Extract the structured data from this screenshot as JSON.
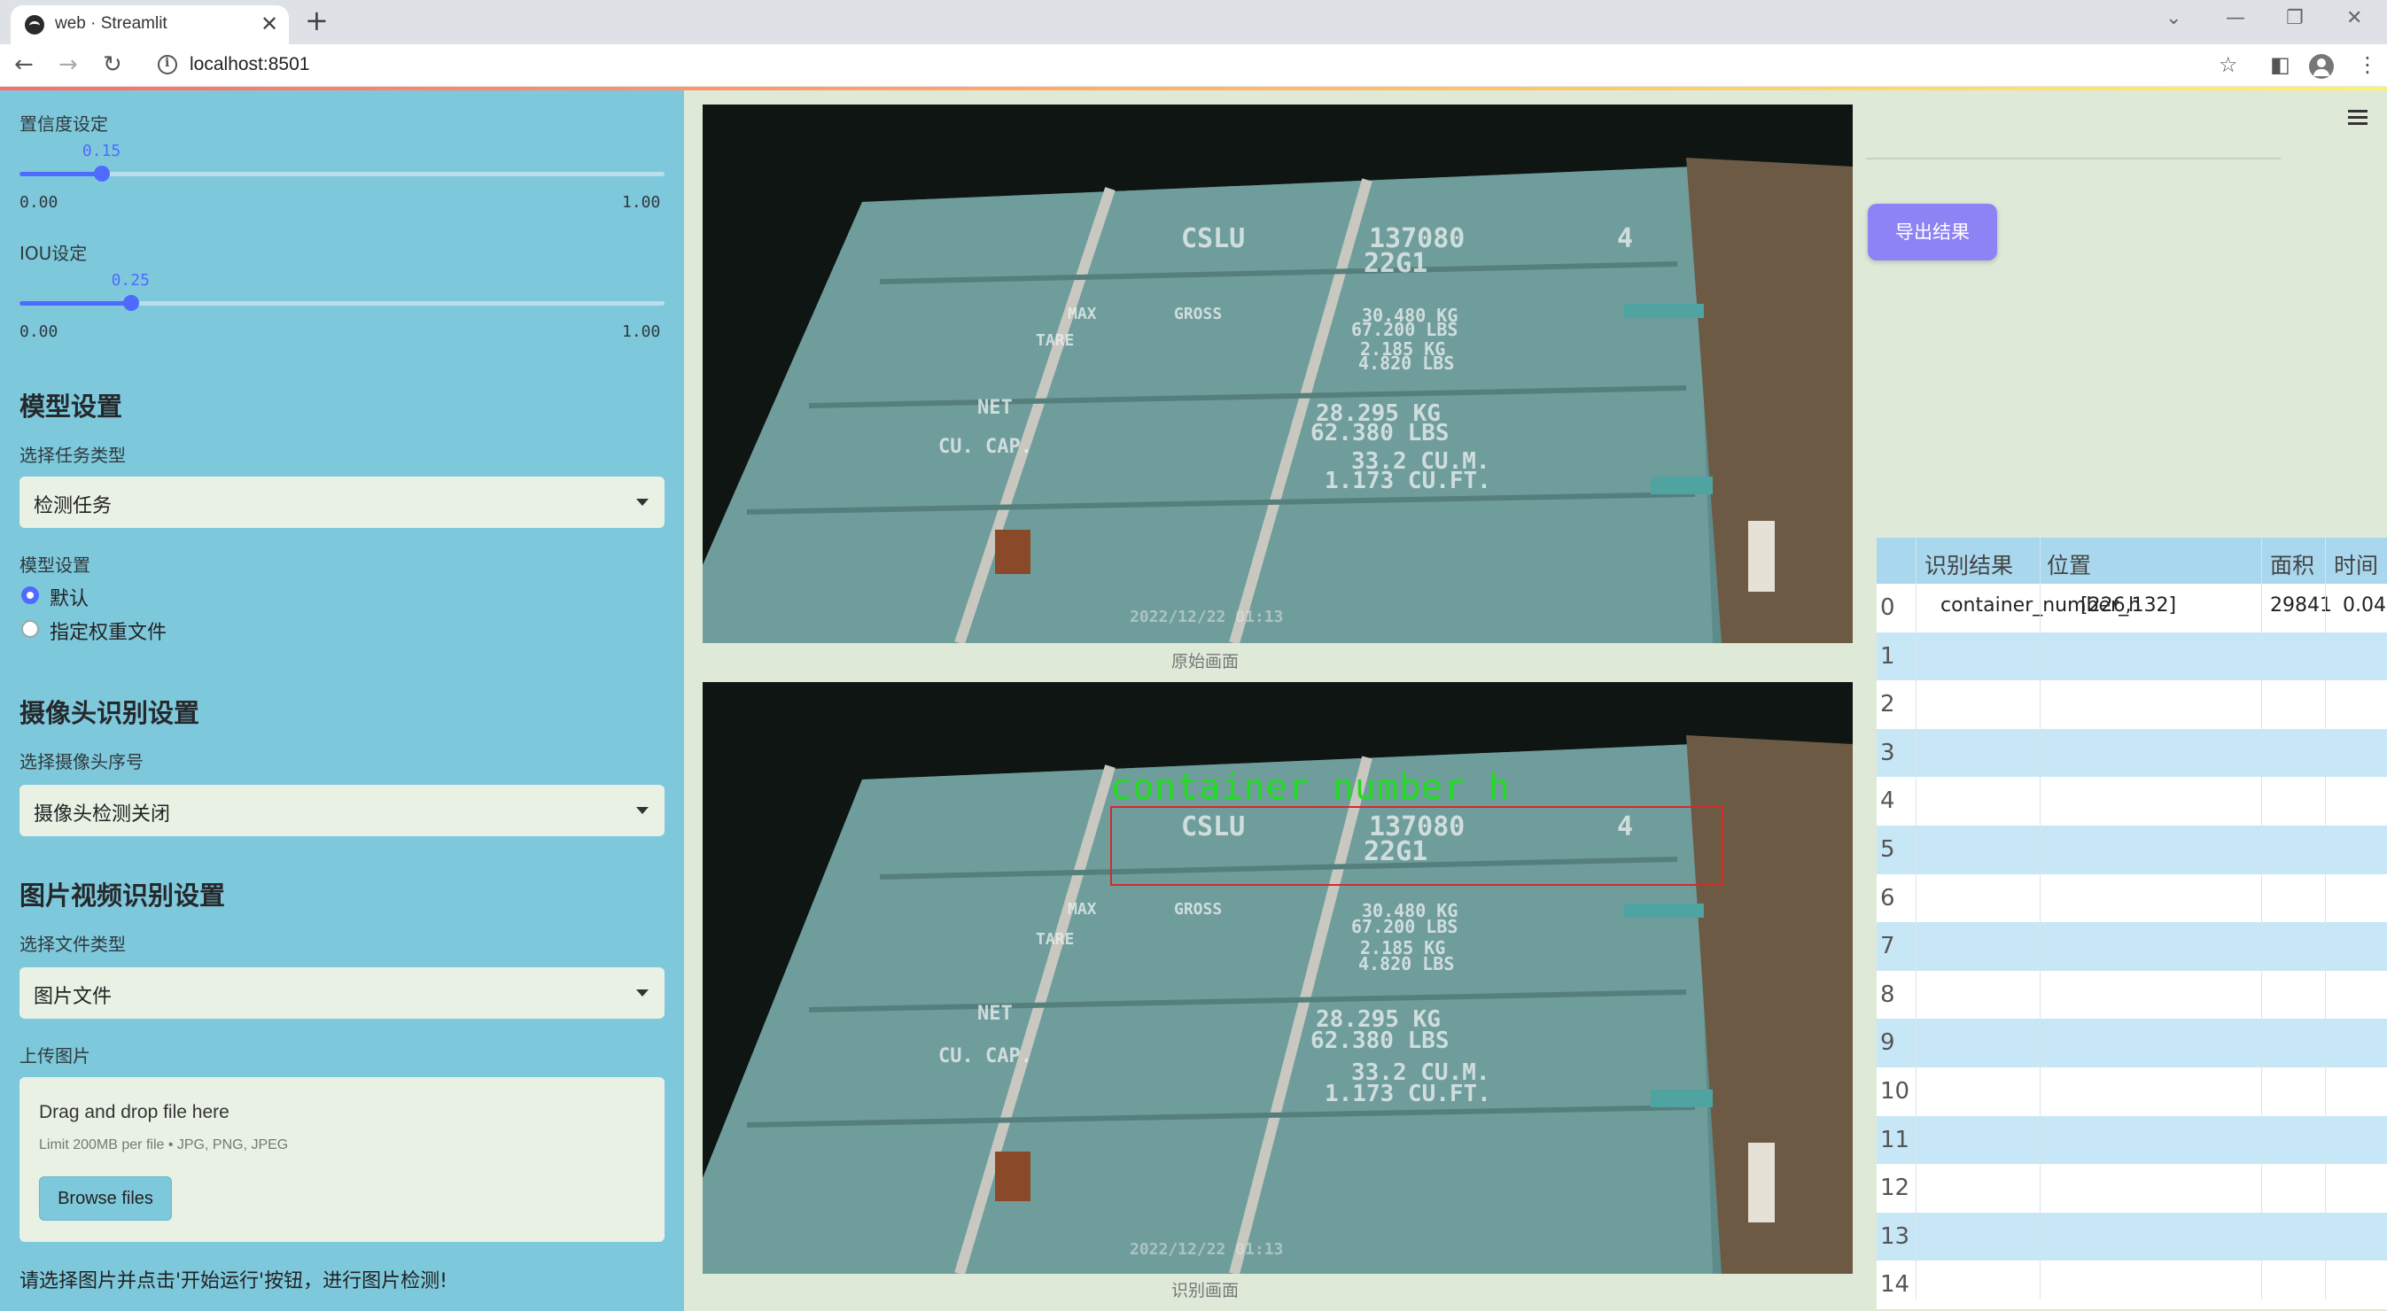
{
  "browser": {
    "tab_title": "web · Streamlit",
    "url": "localhost:8501"
  },
  "sidebar": {
    "confidence": {
      "label": "置信度设定",
      "value": "0.15",
      "level": 0.15,
      "min": "0.00",
      "max": "1.00"
    },
    "iou": {
      "label": "IOU设定",
      "value": "0.25",
      "level": 0.25,
      "min": "0.00",
      "max": "1.00"
    },
    "model_section": {
      "heading": "模型设置",
      "task_label": "选择任务类型",
      "task_value": "检测任务",
      "model_label": "模型设置",
      "options": [
        "默认",
        "指定权重文件"
      ],
      "selected": "默认"
    },
    "camera_section": {
      "heading": "摄像头识别设置",
      "camera_label": "选择摄像头序号",
      "camera_value": "摄像头检测关闭"
    },
    "media_section": {
      "heading": "图片视频识别设置",
      "file_type_label": "选择文件类型",
      "file_type_value": "图片文件",
      "upload_label": "上传图片",
      "dropzone_title": "Drag and drop file here",
      "dropzone_limit": "Limit 200MB per file • JPG, PNG, JPEG",
      "browse_label": "Browse files"
    },
    "hint": "请选择图片并点击'开始运行'按钮，进行图片检测!"
  },
  "main": {
    "original_caption": "原始画面",
    "result_caption": "识别画面",
    "detection_label": "container_number_h",
    "photo_text": {
      "owner": "CSLU",
      "number": "137080",
      "check": "4",
      "type_code": "22G1",
      "max": "MAX",
      "gross": "GROSS",
      "gross_kg": "30.480 KG",
      "gross_lbs": "67.200 LBS",
      "tare": "TARE",
      "tare_kg": "2.185 KG",
      "tare_lbs": "4.820 LBS",
      "net": "NET",
      "net_kg": "28.295 KG",
      "net_lbs": "62.380 LBS",
      "cu_cap": "CU. CAP.",
      "cu_m": "33.2 CU.M.",
      "cu_ft": "1.173 CU.FT.",
      "timestamp": "2022/12/22 01:13"
    }
  },
  "results": {
    "export_label": "导出结果",
    "columns": [
      "识别结果",
      "位置",
      "面积",
      "时间"
    ],
    "rows": [
      {
        "index": "0",
        "label": "container_number_h",
        "position": "[226,132]",
        "area": "29841",
        "time": "0.04"
      },
      {
        "index": "1"
      },
      {
        "index": "2"
      },
      {
        "index": "3"
      },
      {
        "index": "4"
      },
      {
        "index": "5"
      },
      {
        "index": "6"
      },
      {
        "index": "7"
      },
      {
        "index": "8"
      },
      {
        "index": "9"
      },
      {
        "index": "10"
      },
      {
        "index": "11"
      },
      {
        "index": "12"
      },
      {
        "index": "13"
      },
      {
        "index": "14"
      }
    ]
  },
  "colors": {
    "sidebar_bg": "#7ec8dc",
    "main_bg": "#dfe9d8",
    "accent": "#4f6bff",
    "export_button": "#8d83f4",
    "detection_box": "#d42a2a",
    "detection_text": "#22dd22"
  }
}
